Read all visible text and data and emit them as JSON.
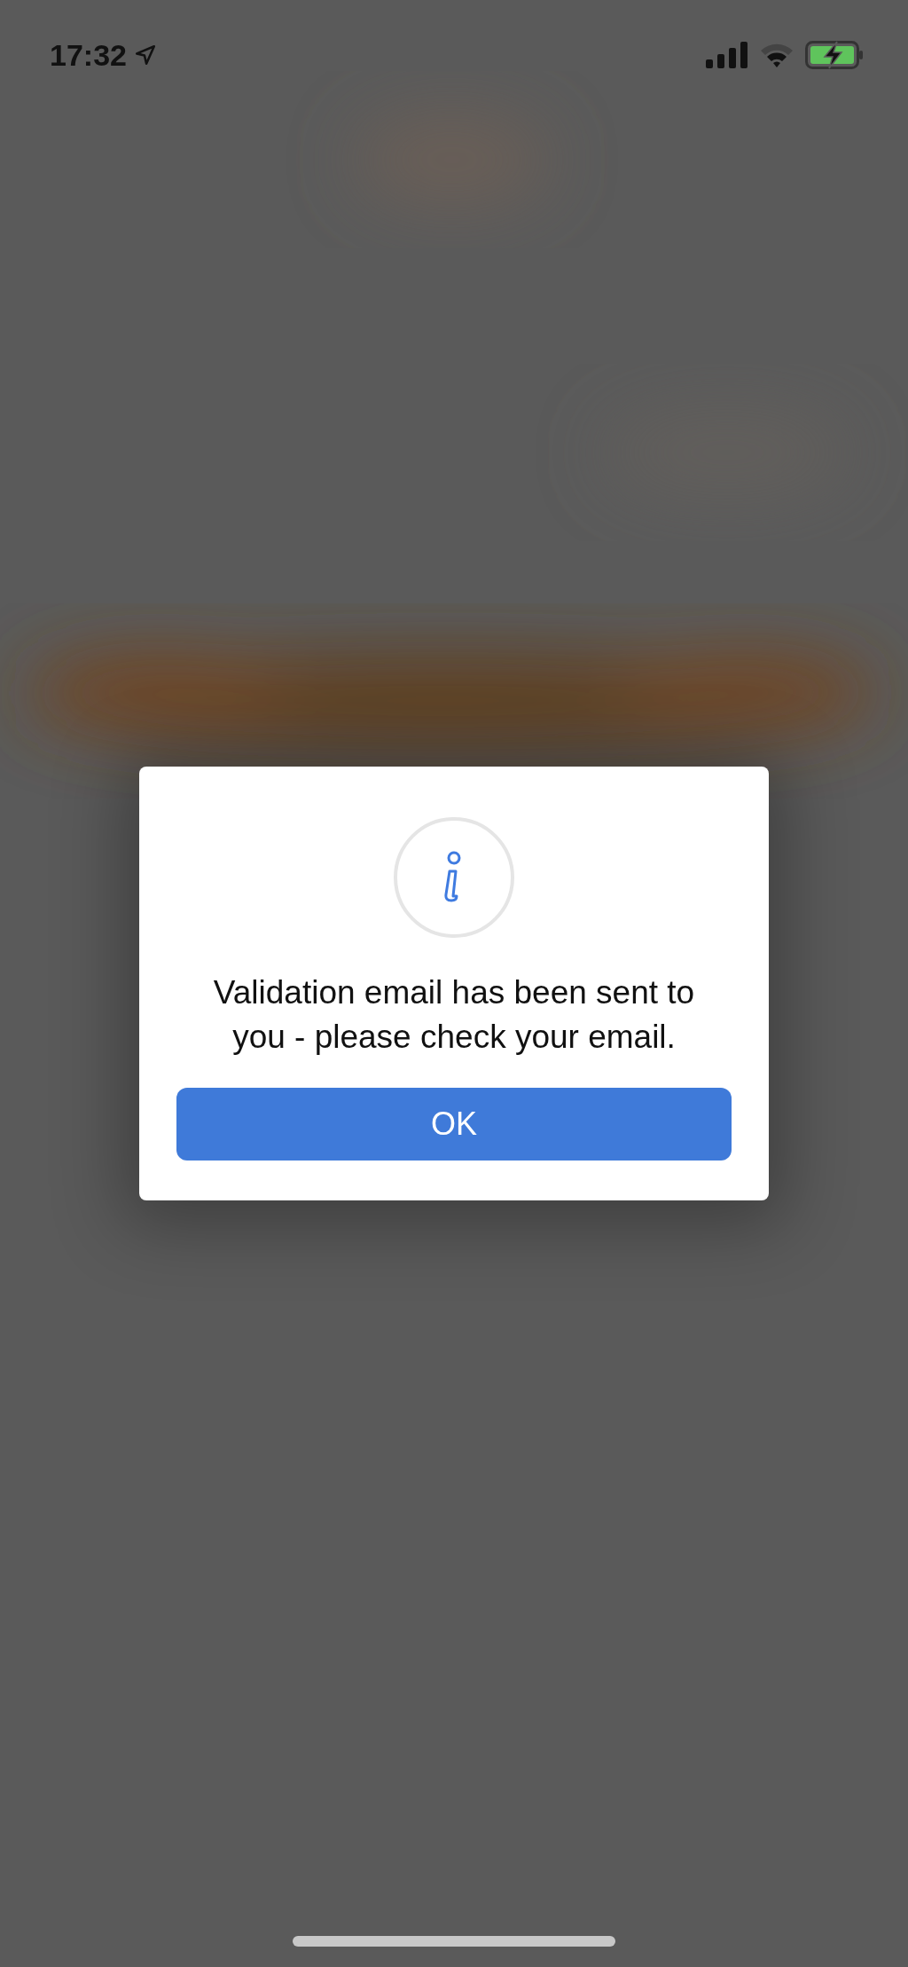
{
  "status_bar": {
    "time": "17:32",
    "battery": {
      "charging": true
    }
  },
  "dialog": {
    "message": "Validation email has been sent to you - please check your email.",
    "buttons": [
      {
        "label": "OK"
      }
    ]
  }
}
